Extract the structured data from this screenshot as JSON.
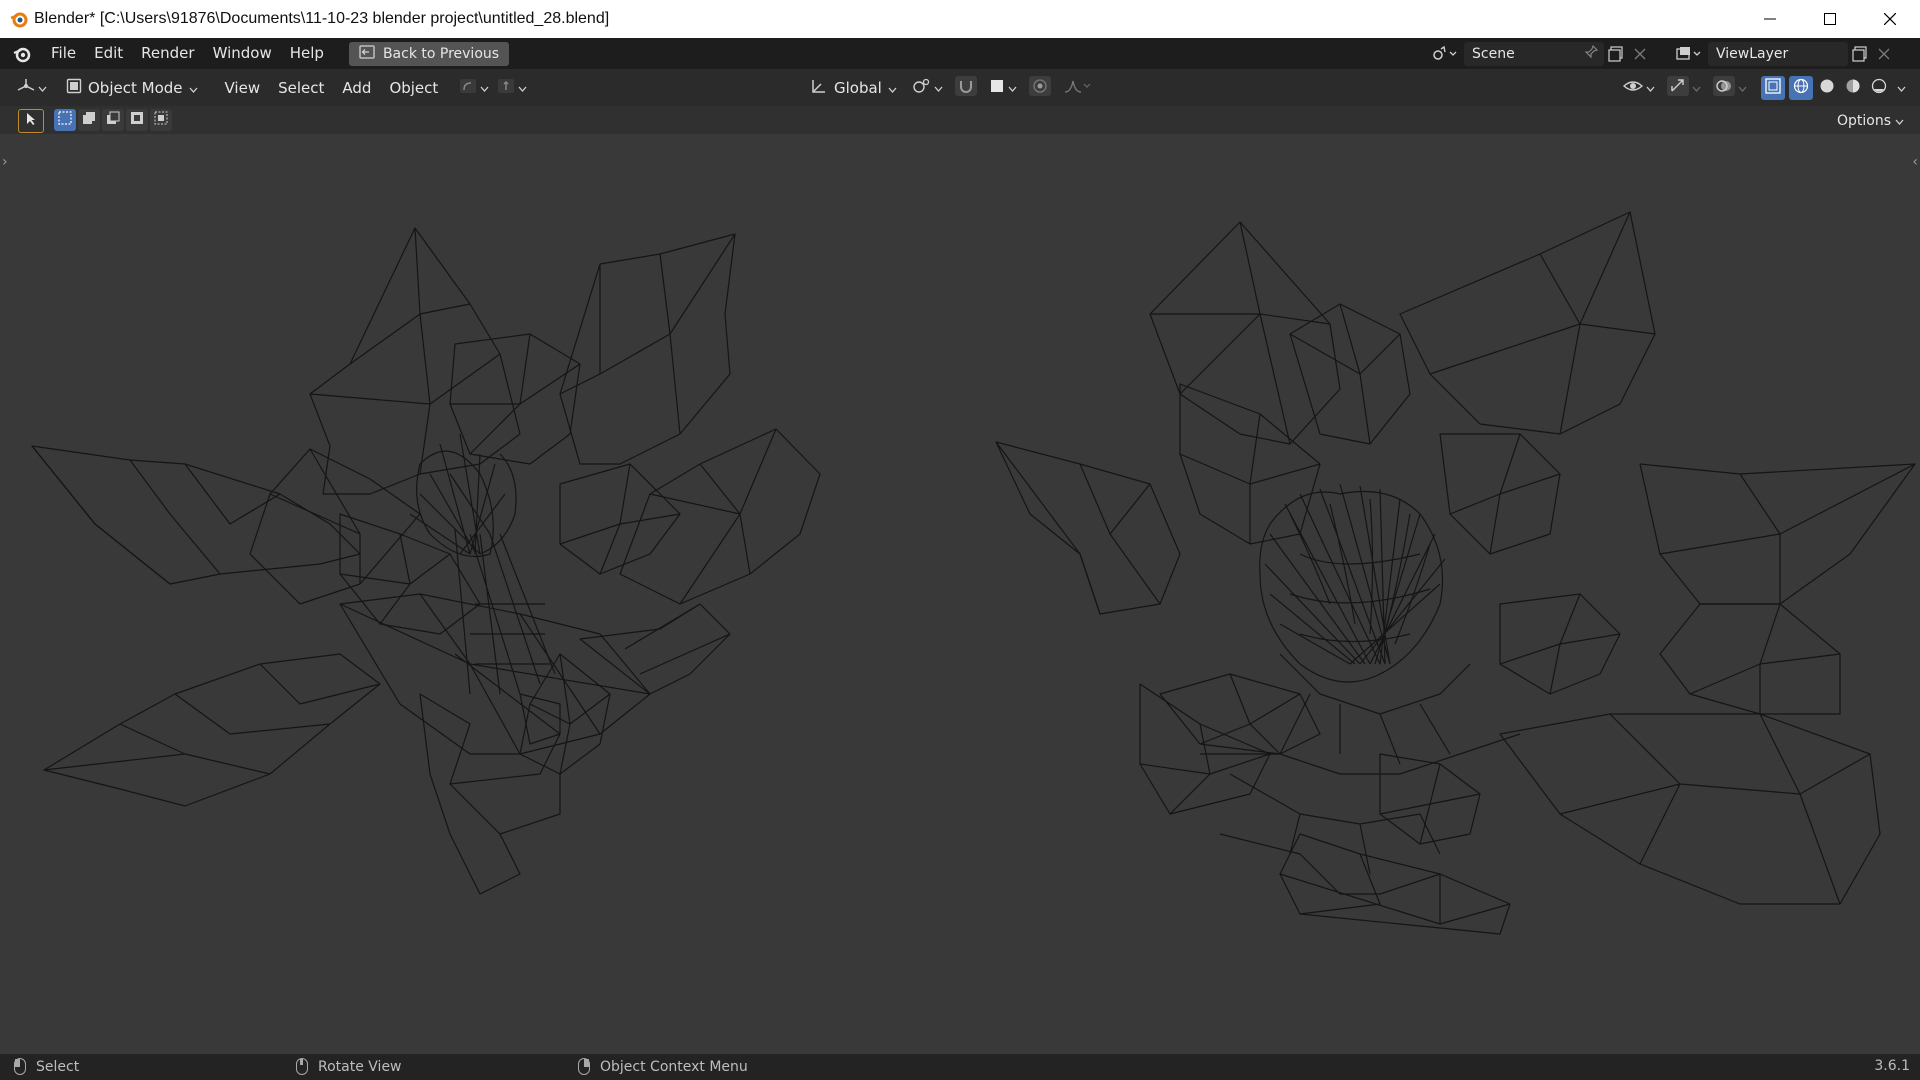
{
  "window": {
    "title": "Blender* [C:\\Users\\91876\\Documents\\11-10-23 blender project\\untitled_28.blend]",
    "controls": [
      "minimize",
      "maximize",
      "close"
    ]
  },
  "topbar": {
    "menus": [
      "File",
      "Edit",
      "Render",
      "Window",
      "Help"
    ],
    "back_button": "Back to Previous",
    "scene": "Scene",
    "view_layer": "ViewLayer"
  },
  "viewport_header": {
    "mode": "Object Mode",
    "menus": [
      "View",
      "Select",
      "Add",
      "Object"
    ],
    "transform_orientation": "Global",
    "shading_active": "wireframe"
  },
  "tool_header": {
    "options_label": "Options"
  },
  "statusbar": {
    "left_click": "Select",
    "middle_click": "Rotate View",
    "right_click": "Object Context Menu",
    "version": "3.6.1"
  },
  "colors": {
    "accent": "#4772b3",
    "titlebar_bg": "#ffffff",
    "topbar_bg": "#1d1d1d",
    "header_bg": "#2b2b2b",
    "viewport_bg": "#393939",
    "wireframe": "#151515",
    "blender_orange": "#e87d0d"
  }
}
